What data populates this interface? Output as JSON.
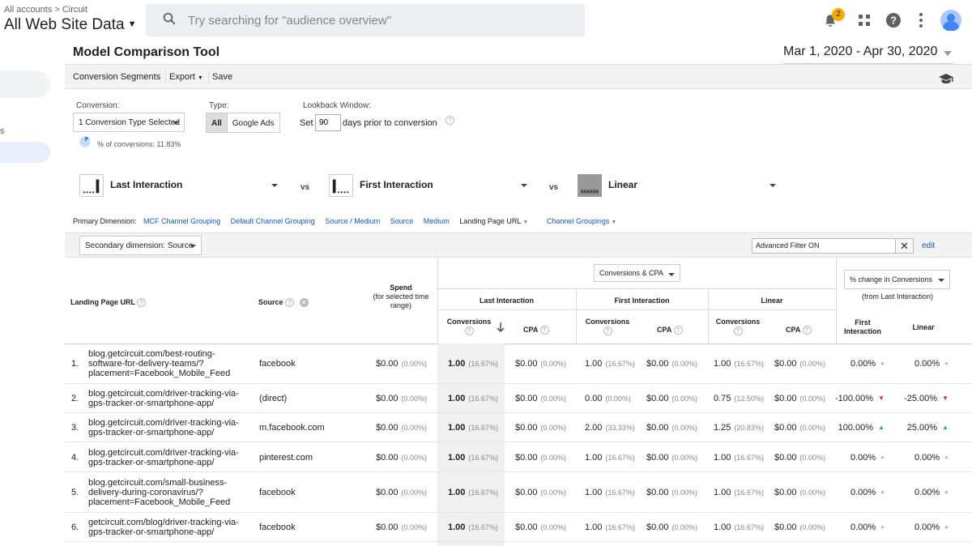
{
  "header": {
    "breadcrumb": "All accounts > Circuit",
    "property": "All Web Site Data",
    "search_placeholder": "Try searching for \"audience overview\"",
    "notif_count": "2"
  },
  "sidebar": {
    "fragment": "s"
  },
  "page": {
    "title": "Model Comparison Tool",
    "date_range": "Mar 1, 2020 - Apr 30, 2020"
  },
  "toolbar": {
    "segments": "Conversion Segments",
    "export": "Export",
    "save": "Save"
  },
  "controls": {
    "conversion_label": "Conversion:",
    "conversion_value": "1 Conversion Type Selected",
    "type_label": "Type:",
    "type_all": "All",
    "type_ads": "Google Ads",
    "lookback_label": "Lookback Window:",
    "lookback_set": "Set",
    "lookback_days": "90",
    "lookback_suffix": "days prior to conversion",
    "pct_text": "% of conversions: 11.83%"
  },
  "models": {
    "m1": "Last Interaction",
    "m2": "First Interaction",
    "m3": "Linear",
    "vs": "vs"
  },
  "dimensions": {
    "label": "Primary Dimension:",
    "items": [
      "MCF Channel Grouping",
      "Default Channel Grouping",
      "Source / Medium",
      "Source",
      "Medium",
      "Landing Page URL",
      "Channel Groupings"
    ]
  },
  "secondary": {
    "label": "Secondary dimension: Source",
    "filter": "Advanced Filter ON",
    "edit": "edit"
  },
  "table": {
    "h_url": "Landing Page URL",
    "h_source": "Source",
    "h_spend": "Spend",
    "h_spend_sub": "(for selected time range)",
    "metric_select": "Conversions & CPA",
    "h_last": "Last Interaction",
    "h_first": "First Interaction",
    "h_linear": "Linear",
    "h_conv": "Conversions",
    "h_cpa": "CPA",
    "change_select": "% change in Conversions",
    "change_sub": "(from Last Interaction)",
    "h_fi": "First Interaction",
    "h_lin": "Linear",
    "rows": [
      {
        "n": "1.",
        "url": [
          "blog.getcircuit.com/best-routing-",
          "software-for-delivery-teams/?",
          "placement=Facebook_Mobile_Feed"
        ],
        "src": "facebook",
        "spend": "$0.00",
        "sp": "(0.00%)",
        "c1": "1.00",
        "c1p": "(16.67%)",
        "cpa1": "$0.00",
        "cpa1p": "(0.00%)",
        "c2": "1.00",
        "c2p": "(16.67%)",
        "cpa2": "$0.00",
        "cpa2p": "(0.00%)",
        "c3": "1.00",
        "c3p": "(16.67%)",
        "cpa3": "$0.00",
        "cpa3p": "(0.00%)",
        "ch1": "0.00%",
        "ch2": "0.00%",
        "d1": "gray",
        "d2": "gray"
      },
      {
        "n": "2.",
        "url": [
          "blog.getcircuit.com/driver-tracking-via-",
          "gps-tracker-or-smartphone-app/"
        ],
        "src": "(direct)",
        "spend": "$0.00",
        "sp": "(0.00%)",
        "c1": "1.00",
        "c1p": "(16.67%)",
        "cpa1": "$0.00",
        "cpa1p": "(0.00%)",
        "c2": "0.00",
        "c2p": "(0.00%)",
        "cpa2": "$0.00",
        "cpa2p": "(0.00%)",
        "c3": "0.75",
        "c3p": "(12.50%)",
        "cpa3": "$0.00",
        "cpa3p": "(0.00%)",
        "ch1": "-100.00%",
        "ch2": "-25.00%",
        "d1": "red",
        "d2": "red"
      },
      {
        "n": "3.",
        "url": [
          "blog.getcircuit.com/driver-tracking-via-",
          "gps-tracker-or-smartphone-app/"
        ],
        "src": "m.facebook.com",
        "spend": "$0.00",
        "sp": "(0.00%)",
        "c1": "1.00",
        "c1p": "(16.67%)",
        "cpa1": "$0.00",
        "cpa1p": "(0.00%)",
        "c2": "2.00",
        "c2p": "(33.33%)",
        "cpa2": "$0.00",
        "cpa2p": "(0.00%)",
        "c3": "1.25",
        "c3p": "(20.83%)",
        "cpa3": "$0.00",
        "cpa3p": "(0.00%)",
        "ch1": "100.00%",
        "ch2": "25.00%",
        "d1": "green",
        "d2": "green"
      },
      {
        "n": "4.",
        "url": [
          "blog.getcircuit.com/driver-tracking-via-",
          "gps-tracker-or-smartphone-app/"
        ],
        "src": "pinterest.com",
        "spend": "$0.00",
        "sp": "(0.00%)",
        "c1": "1.00",
        "c1p": "(16.67%)",
        "cpa1": "$0.00",
        "cpa1p": "(0.00%)",
        "c2": "1.00",
        "c2p": "(16.67%)",
        "cpa2": "$0.00",
        "cpa2p": "(0.00%)",
        "c3": "1.00",
        "c3p": "(16.67%)",
        "cpa3": "$0.00",
        "cpa3p": "(0.00%)",
        "ch1": "0.00%",
        "ch2": "0.00%",
        "d1": "gray",
        "d2": "gray"
      },
      {
        "n": "5.",
        "url": [
          "blog.getcircuit.com/small-business-",
          "delivery-during-coronavirus/?",
          "placement=Facebook_Mobile_Feed"
        ],
        "src": "facebook",
        "spend": "$0.00",
        "sp": "(0.00%)",
        "c1": "1.00",
        "c1p": "(16.67%)",
        "cpa1": "$0.00",
        "cpa1p": "(0.00%)",
        "c2": "1.00",
        "c2p": "(16.67%)",
        "cpa2": "$0.00",
        "cpa2p": "(0.00%)",
        "c3": "1.00",
        "c3p": "(16.67%)",
        "cpa3": "$0.00",
        "cpa3p": "(0.00%)",
        "ch1": "0.00%",
        "ch2": "0.00%",
        "d1": "gray",
        "d2": "gray"
      },
      {
        "n": "6.",
        "url": [
          "getcircuit.com/blog/driver-tracking-via-",
          "gps-tracker-or-smartphone-app/"
        ],
        "src": "facebook",
        "spend": "$0.00",
        "sp": "(0.00%)",
        "c1": "1.00",
        "c1p": "(16.67%)",
        "cpa1": "$0.00",
        "cpa1p": "(0.00%)",
        "c2": "1.00",
        "c2p": "(16.67%)",
        "cpa2": "$0.00",
        "cpa2p": "(0.00%)",
        "c3": "1.00",
        "c3p": "(16.67%)",
        "cpa3": "$0.00",
        "cpa3p": "(0.00%)",
        "ch1": "0.00%",
        "ch2": "0.00%",
        "d1": "gray",
        "d2": "gray"
      }
    ]
  },
  "colors": {
    "link": "#1155cc",
    "red": "#d93025",
    "green": "#34a853",
    "gray": "#bbbbbb"
  }
}
